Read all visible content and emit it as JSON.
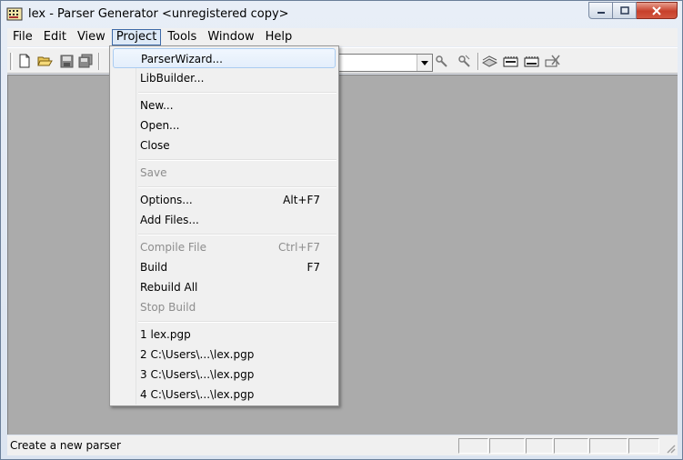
{
  "window": {
    "title": "lex - Parser Generator <unregistered copy>"
  },
  "menubar": {
    "items": [
      {
        "label": "File"
      },
      {
        "label": "Edit"
      },
      {
        "label": "View"
      },
      {
        "label": "Project"
      },
      {
        "label": "Tools"
      },
      {
        "label": "Window"
      },
      {
        "label": "Help"
      }
    ],
    "active": "Project"
  },
  "toolbar": {
    "icons": [
      "new-file-icon",
      "open-folder-icon",
      "save-icon",
      "save-all-icon",
      "compile-icon",
      "build-icon",
      "rebuild-icon",
      "stop-build-icon",
      "lex-icon",
      "yacc-icon",
      "clear-icon"
    ],
    "combo_value": ""
  },
  "project_menu": {
    "items": [
      {
        "label": "ParserWizard...",
        "shortcut": "",
        "enabled": true,
        "highlighted": true
      },
      {
        "label": "LibBuilder...",
        "shortcut": "",
        "enabled": true
      },
      {
        "label": "New...",
        "shortcut": "",
        "enabled": true
      },
      {
        "label": "Open...",
        "shortcut": "",
        "enabled": true
      },
      {
        "label": "Close",
        "shortcut": "",
        "enabled": true
      },
      {
        "label": "Save",
        "shortcut": "",
        "enabled": false
      },
      {
        "label": "Options...",
        "shortcut": "Alt+F7",
        "enabled": true
      },
      {
        "label": "Add Files...",
        "shortcut": "",
        "enabled": true
      },
      {
        "label": "Compile File",
        "shortcut": "Ctrl+F7",
        "enabled": false
      },
      {
        "label": "Build",
        "shortcut": "F7",
        "enabled": true
      },
      {
        "label": "Rebuild All",
        "shortcut": "",
        "enabled": true
      },
      {
        "label": "Stop Build",
        "shortcut": "",
        "enabled": false
      },
      {
        "label": "1 lex.pgp",
        "shortcut": "",
        "enabled": true
      },
      {
        "label": "2 C:\\Users\\...\\lex.pgp",
        "shortcut": "",
        "enabled": true
      },
      {
        "label": "3 C:\\Users\\...\\lex.pgp",
        "shortcut": "",
        "enabled": true
      },
      {
        "label": "4 C:\\Users\\...\\lex.pgp",
        "shortcut": "",
        "enabled": true
      }
    ]
  },
  "statusbar": {
    "text": "Create a new parser"
  },
  "colors": {
    "client_bg": "#ababab",
    "menu_highlight_border": "#aaccf1",
    "disabled_text": "#8d8d8d",
    "close_button": "#c7402b"
  }
}
